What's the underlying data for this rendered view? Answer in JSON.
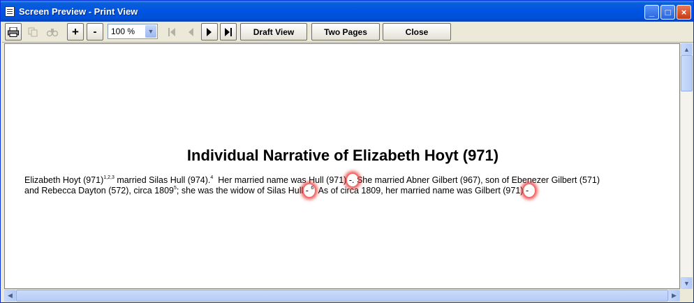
{
  "window": {
    "title": "Screen Preview - Print View"
  },
  "title_buttons": {
    "minimize": "_",
    "maximize": "□",
    "close": "×"
  },
  "toolbar": {
    "zoom_value": "100 %",
    "zoom_in_label": "+",
    "zoom_out_label": "-",
    "draft_view_label": "Draft View",
    "two_pages_label": "Two Pages",
    "close_label": "Close"
  },
  "icons": {
    "print": "print-icon",
    "copy": "copy-icon",
    "find": "binoculars-icon",
    "first": "first-page-icon",
    "prev": "previous-page-icon",
    "next": "next-page-icon",
    "last": "last-page-icon"
  },
  "document": {
    "heading": "Individual Narrative of Elizabeth Hoyt (971)",
    "line1_a": "Elizabeth Hoyt (971)",
    "line1_sup1": "1,2,3",
    "line1_b": " married Silas Hull (974).",
    "line1_sup2": "4",
    "line1_c": "  Her married name was Hull (971)",
    "dash": "-",
    "line1_d": ". She married Abner Gilbert (967), son of Ebenezer Gilbert (571)",
    "line2_a": "and Rebecca Dayton (572), circa 1809",
    "line2_sup1": "5",
    "line2_b": "; she was the widow of Silas Hull",
    "line2_sup2": "6",
    "line2_c": "  As of circa 1809, her married name was Gilbert (971)",
    "line2_d": "."
  },
  "colors": {
    "titlebar": "#0054e3",
    "highlight": "#e62828"
  }
}
